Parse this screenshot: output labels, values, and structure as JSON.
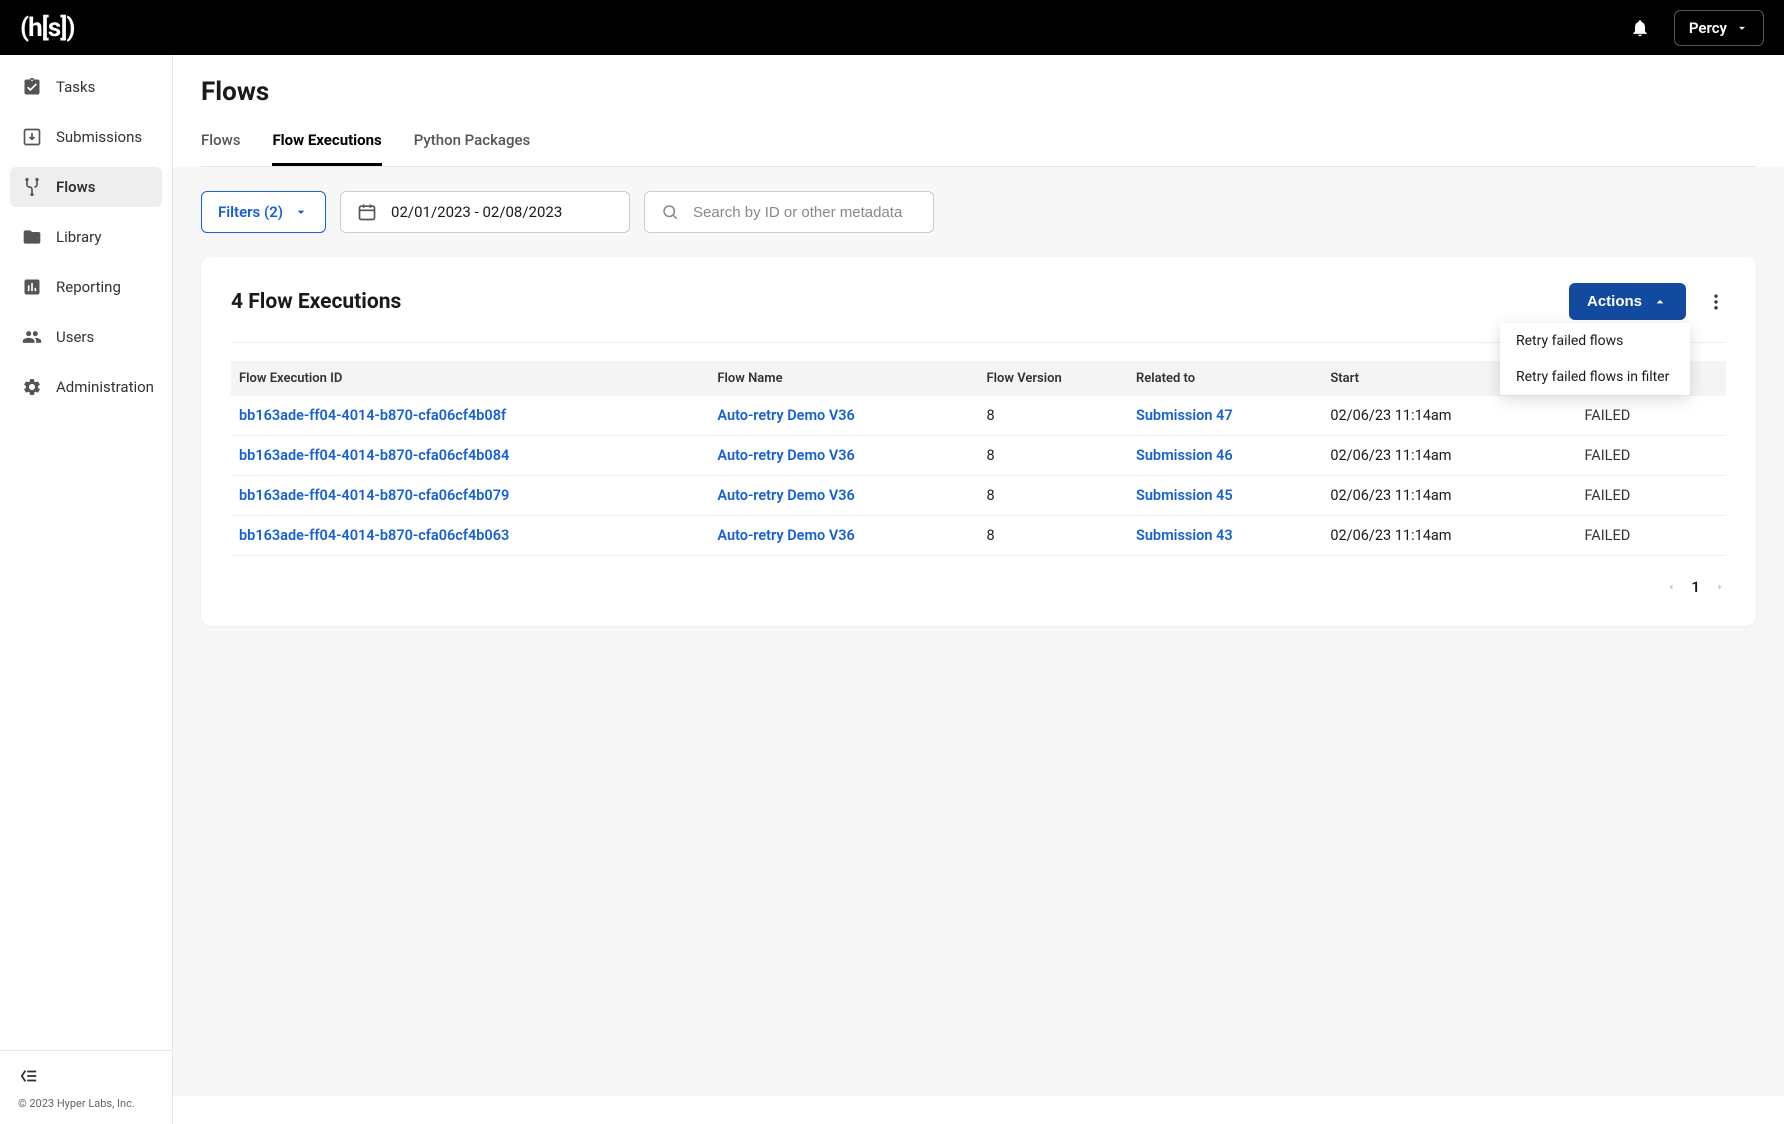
{
  "header": {
    "logo": "(h[s])",
    "user_name": "Percy"
  },
  "sidebar": {
    "items": [
      {
        "label": "Tasks",
        "icon": "checklist-icon"
      },
      {
        "label": "Submissions",
        "icon": "download-icon"
      },
      {
        "label": "Flows",
        "icon": "flows-icon"
      },
      {
        "label": "Library",
        "icon": "folder-icon"
      },
      {
        "label": "Reporting",
        "icon": "bar-chart-icon"
      },
      {
        "label": "Users",
        "icon": "people-icon"
      },
      {
        "label": "Administration",
        "icon": "gear-icon"
      }
    ],
    "copyright": "© 2023 Hyper Labs, Inc."
  },
  "page": {
    "title": "Flows",
    "tabs": [
      {
        "label": "Flows"
      },
      {
        "label": "Flow Executions"
      },
      {
        "label": "Python Packages"
      }
    ]
  },
  "filters": {
    "filters_label": "Filters (2)",
    "date_range": "02/01/2023 - 02/08/2023",
    "search_placeholder": "Search by ID or other metadata"
  },
  "card": {
    "title": "4 Flow Executions",
    "actions_label": "Actions",
    "dropdown": [
      "Retry failed flows",
      "Retry failed flows in filter"
    ],
    "columns": {
      "id": "Flow Execution ID",
      "name": "Flow Name",
      "version": "Flow Version",
      "related": "Related to",
      "start": "Start",
      "status": ""
    },
    "rows": [
      {
        "id": "bb163ade-ff04-4014-b870-cfa06cf4b08f",
        "name": "Auto-retry Demo V36",
        "version": "8",
        "related": "Submission 47",
        "start": "02/06/23 11:14am",
        "status": "FAILED"
      },
      {
        "id": "bb163ade-ff04-4014-b870-cfa06cf4b084",
        "name": "Auto-retry Demo V36",
        "version": "8",
        "related": "Submission 46",
        "start": "02/06/23 11:14am",
        "status": "FAILED"
      },
      {
        "id": "bb163ade-ff04-4014-b870-cfa06cf4b079",
        "name": "Auto-retry Demo V36",
        "version": "8",
        "related": "Submission 45",
        "start": "02/06/23 11:14am",
        "status": "FAILED"
      },
      {
        "id": "bb163ade-ff04-4014-b870-cfa06cf4b063",
        "name": "Auto-retry Demo V36",
        "version": "8",
        "related": "Submission 43",
        "start": "02/06/23 11:14am",
        "status": "FAILED"
      }
    ],
    "pagination": {
      "page": "1"
    }
  }
}
